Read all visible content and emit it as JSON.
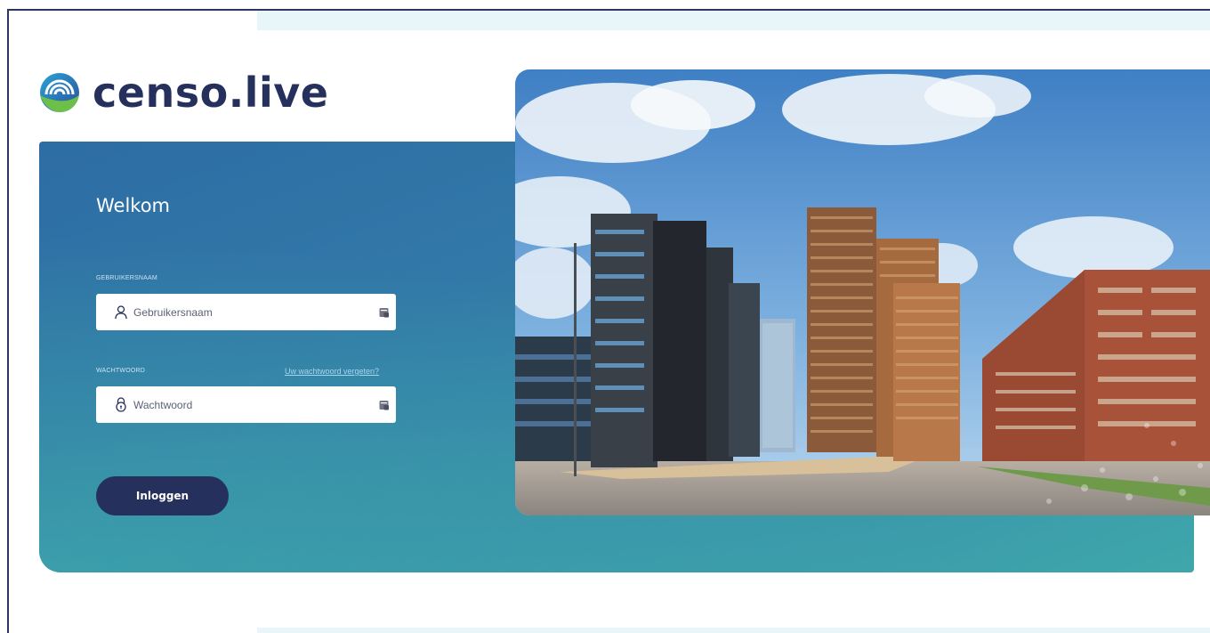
{
  "brand": {
    "name": "censo.live",
    "primary_color": "#26305c",
    "accent_color": "#3a96aa"
  },
  "login": {
    "title": "Welkom",
    "username": {
      "label": "GEBRUIKERSNAAM",
      "placeholder": "Gebruikersnaam",
      "icon": "user-icon"
    },
    "password": {
      "label": "WACHTWOORD",
      "placeholder": "Wachtwoord",
      "icon": "lock-icon",
      "forgot_link": "Uw wachtwoord vergeten?"
    },
    "submit_label": "Inloggen"
  },
  "hero_image": {
    "subject": "city-buildings-photo"
  }
}
